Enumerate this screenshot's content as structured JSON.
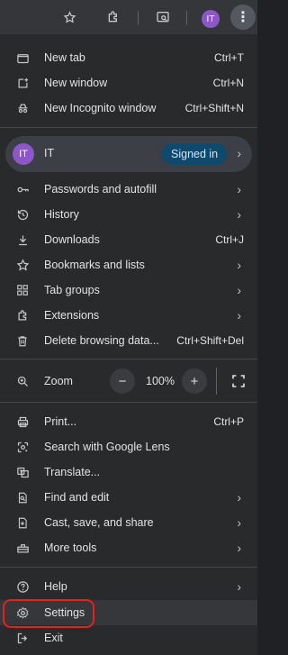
{
  "toolbar": {
    "icons": [
      "star-icon",
      "extensions-icon",
      "tab-search-icon",
      "kebab-menu-icon"
    ],
    "avatar_initials": "IT"
  },
  "menu": {
    "group1": [
      {
        "label": "New tab",
        "shortcut": "Ctrl+T",
        "icon": "new-tab-icon"
      },
      {
        "label": "New window",
        "shortcut": "Ctrl+N",
        "icon": "new-window-icon"
      },
      {
        "label": "New Incognito window",
        "shortcut": "Ctrl+Shift+N",
        "icon": "incognito-icon"
      }
    ],
    "profile": {
      "initials": "IT",
      "name": "IT",
      "status": "Signed in"
    },
    "group2": [
      {
        "label": "Passwords and autofill",
        "icon": "key-icon",
        "submenu": true
      },
      {
        "label": "History",
        "icon": "history-icon",
        "submenu": true
      },
      {
        "label": "Downloads",
        "shortcut": "Ctrl+J",
        "icon": "download-icon"
      },
      {
        "label": "Bookmarks and lists",
        "icon": "star-icon",
        "submenu": true
      },
      {
        "label": "Tab groups",
        "icon": "tab-groups-icon",
        "submenu": true
      },
      {
        "label": "Extensions",
        "icon": "extensions-icon",
        "submenu": true
      },
      {
        "label": "Delete browsing data...",
        "shortcut": "Ctrl+Shift+Del",
        "icon": "trash-icon"
      }
    ],
    "zoom": {
      "label": "Zoom",
      "minus": "−",
      "value": "100%",
      "plus": "+"
    },
    "group3": [
      {
        "label": "Print...",
        "shortcut": "Ctrl+P",
        "icon": "print-icon"
      },
      {
        "label": "Search with Google Lens",
        "icon": "lens-icon"
      },
      {
        "label": "Translate...",
        "icon": "translate-icon"
      },
      {
        "label": "Find and edit",
        "icon": "find-icon",
        "submenu": true
      },
      {
        "label": "Cast, save, and share",
        "icon": "cast-icon",
        "submenu": true
      },
      {
        "label": "More tools",
        "icon": "toolbox-icon",
        "submenu": true
      }
    ],
    "group4": [
      {
        "label": "Help",
        "icon": "help-icon",
        "submenu": true
      },
      {
        "label": "Settings",
        "icon": "gear-icon"
      },
      {
        "label": "Exit",
        "icon": "exit-icon"
      }
    ]
  },
  "colors": {
    "accent": "#0e4a6e",
    "highlight": "#e2231a",
    "avatar": "#8e57c9"
  }
}
